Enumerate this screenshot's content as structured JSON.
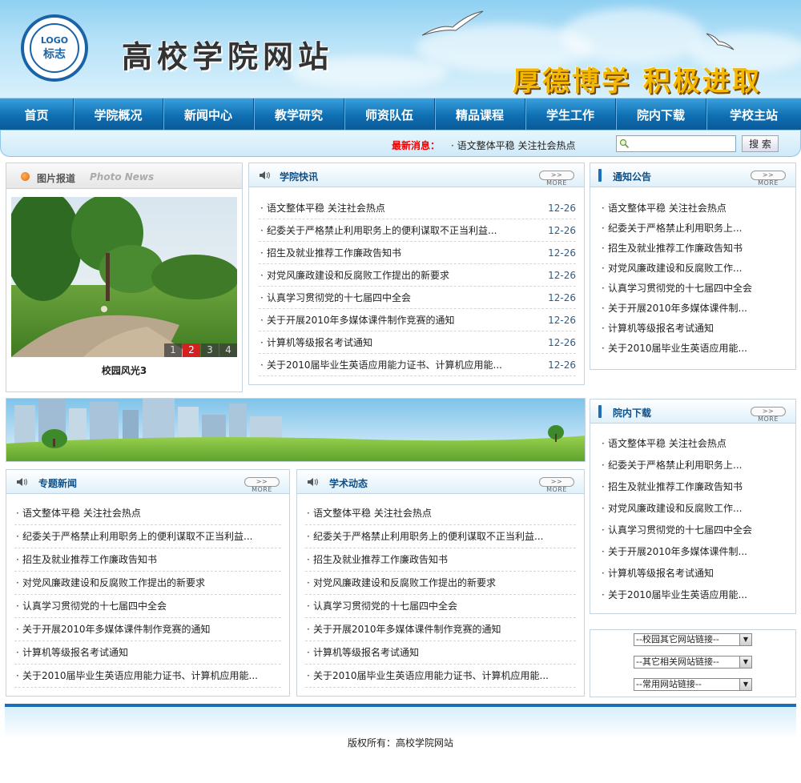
{
  "header": {
    "logo_line1": "LOGO",
    "logo_line2": "标志",
    "site_title": "高校学院网站",
    "slogan": "厚德博学 积极进取"
  },
  "nav": {
    "items": [
      "首页",
      "学院概况",
      "新闻中心",
      "教学研究",
      "师资队伍",
      "精品课程",
      "学生工作",
      "院内下载",
      "学校主站"
    ]
  },
  "search": {
    "latest_label": "最新消息：",
    "latest_text": "· 语文整体平稳 关注社会热点",
    "input_value": "",
    "button_label": "搜 索"
  },
  "photo_news": {
    "title": "图片报道",
    "subtitle": "Photo News",
    "pages": [
      "1",
      "2",
      "3",
      "4"
    ],
    "active_page": "2",
    "caption": "校园风光3"
  },
  "college_news": {
    "title": "学院快讯",
    "more": ">> MORE",
    "items": [
      {
        "text": "语文整体平稳 关注社会热点",
        "date": "12-26"
      },
      {
        "text": "纪委关于严格禁止利用职务上的便利谋取不正当利益...",
        "date": "12-26"
      },
      {
        "text": "招生及就业推荐工作廉政告知书",
        "date": "12-26"
      },
      {
        "text": "对党风廉政建设和反腐败工作提出的新要求",
        "date": "12-26"
      },
      {
        "text": "认真学习贯彻党的十七届四中全会",
        "date": "12-26"
      },
      {
        "text": "关于开展2010年多媒体课件制作竞赛的通知",
        "date": "12-26"
      },
      {
        "text": "计算机等级报名考试通知",
        "date": "12-26"
      },
      {
        "text": "关于2010届毕业生英语应用能力证书、计算机应用能...",
        "date": "12-26"
      }
    ]
  },
  "notices": {
    "title": "通知公告",
    "more": ">> MORE",
    "items": [
      "语文整体平稳 关注社会热点",
      "纪委关于严格禁止利用职务上...",
      "招生及就业推荐工作廉政告知书",
      "对党风廉政建设和反腐败工作...",
      "认真学习贯彻党的十七届四中全会",
      "关于开展2010年多媒体课件制...",
      "计算机等级报名考试通知",
      "关于2010届毕业生英语应用能..."
    ]
  },
  "special_news": {
    "title": "专题新闻",
    "more": ">> MORE",
    "items": [
      "语文整体平稳 关注社会热点",
      "纪委关于严格禁止利用职务上的便利谋取不正当利益...",
      "招生及就业推荐工作廉政告知书",
      "对党风廉政建设和反腐败工作提出的新要求",
      "认真学习贯彻党的十七届四中全会",
      "关于开展2010年多媒体课件制作竞赛的通知",
      "计算机等级报名考试通知",
      "关于2010届毕业生英语应用能力证书、计算机应用能..."
    ]
  },
  "academic": {
    "title": "学术动态",
    "more": ">> MORE",
    "items": [
      "语文整体平稳 关注社会热点",
      "纪委关于严格禁止利用职务上的便利谋取不正当利益...",
      "招生及就业推荐工作廉政告知书",
      "对党风廉政建设和反腐败工作提出的新要求",
      "认真学习贯彻党的十七届四中全会",
      "关于开展2010年多媒体课件制作竞赛的通知",
      "计算机等级报名考试通知",
      "关于2010届毕业生英语应用能力证书、计算机应用能..."
    ]
  },
  "downloads": {
    "title": "院内下载",
    "more": ">> MORE",
    "items": [
      "语文整体平稳 关注社会热点",
      "纪委关于严格禁止利用职务上...",
      "招生及就业推荐工作廉政告知书",
      "对党风廉政建设和反腐败工作...",
      "认真学习贯彻党的十七届四中全会",
      "关于开展2010年多媒体课件制...",
      "计算机等级报名考试通知",
      "关于2010届毕业生英语应用能..."
    ]
  },
  "links": {
    "selects": [
      "--校园其它网站链接--",
      "--其它相关网站链接--",
      "--常用网站链接--"
    ]
  },
  "footer": {
    "text": "版权所有：高校学院网站"
  }
}
